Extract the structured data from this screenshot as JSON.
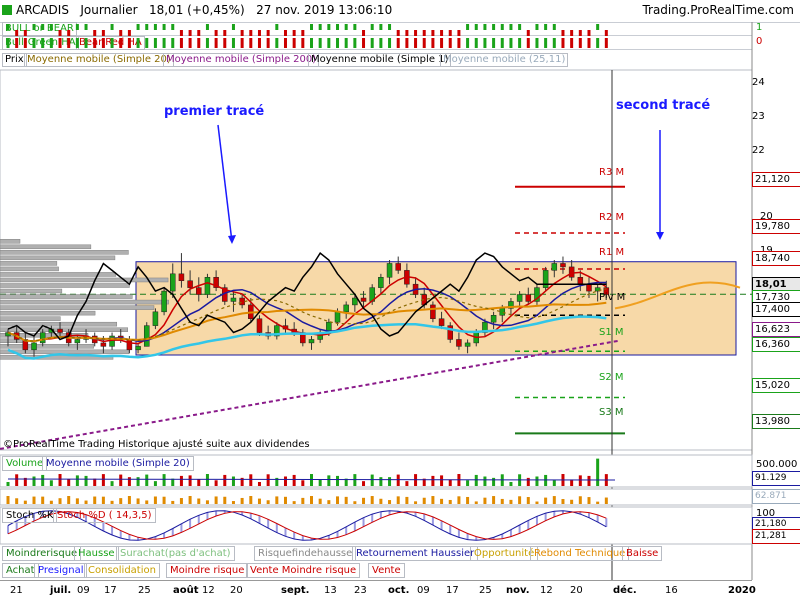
{
  "header": {
    "title": "ARCADIS   Journalier   18,01 (+0,45%)   27 nov. 2019 13:06:10",
    "source": "Trading.ProRealTime.com"
  },
  "indicator_rows": {
    "bull_bear": {
      "label": "BULL or BEAR",
      "right_value": "1"
    },
    "ha": {
      "label1": "Bull-Green HA",
      "label2": "Bear-Red HA",
      "right_value": "0"
    }
  },
  "legend": {
    "prix": "Prix",
    "mm20": "Moyenne mobile (Simple 20)",
    "mm200": "Moyenne mobile (Simple 200)",
    "mm1": "Moyenne mobile (Simple 1)",
    "extra": "Moyenne mobile (25,11)"
  },
  "annotations": {
    "first": "premier tracé",
    "second": "second tracé",
    "copyright": "©ProRealTime Trading  Historique ajusté suite aux dividendes"
  },
  "price_axis": {
    "ticks": [
      "24",
      "23",
      "22",
      "21",
      "20",
      "19",
      "18",
      "17",
      "16"
    ],
    "boxes": {
      "r3": "21,120",
      "r2": "19,780",
      "r1": "18,740",
      "current": "18,01",
      "piv_box": "17,730",
      "piv": "17,400",
      "s1": "16,623",
      "s1b": "16,360",
      "s2": "15,020",
      "s3": "13,980"
    }
  },
  "pivot_labels": {
    "r3": "R3 M",
    "r2": "R2 M",
    "r1": "R1 M",
    "piv": "Piv M",
    "s1": "S1 M",
    "s2": "S2 M",
    "s3": "S3 M"
  },
  "volume": {
    "label1": "Volume",
    "label2": "Moyenne mobile (Simple 20)",
    "right1": "500.000",
    "right2": "91.129"
  },
  "second_vol": {
    "right": "62.871"
  },
  "stoch": {
    "label1": "Stoch %K",
    "label2": "Stoch %D ( 14,3,5)",
    "ticks": [
      "100",
      "50",
      "0"
    ],
    "right1": "21,180",
    "right2": "21,281"
  },
  "signal_row1": {
    "items": [
      "Moindrerisque",
      "Hausse",
      "Surachat(pas d'achat)",
      "Risquefindehausse",
      "Retournement Haussier",
      "Opportunité",
      "Rebond Technique",
      "Baisse"
    ],
    "colors": [
      "#1a7a1a",
      "#1aa31a",
      "#7fc07f",
      "#888888",
      "#1a1aa0",
      "#c8a000",
      "#e08a00",
      "#cc0000"
    ]
  },
  "signal_row2": {
    "items": [
      "Achat",
      "Presignal",
      "Consolidation",
      "Moindre risque",
      "Vente Moindre risque",
      "Vente"
    ],
    "colors": [
      "#1a7a1a",
      "#1a1aff",
      "#c8a000",
      "#cc0000",
      "#cc0000",
      "#cc0000"
    ]
  },
  "x_axis": {
    "labels": [
      "21",
      "juil.",
      "09",
      "17",
      "25",
      "août",
      "12",
      "20",
      "sept.",
      "13",
      "23",
      "oct.",
      "09",
      "17",
      "25",
      "nov.",
      "12",
      "20",
      "déc.",
      "16",
      "2020"
    ],
    "bold": [
      "juil.",
      "août",
      "sept.",
      "oct.",
      "nov.",
      "déc.",
      "2020"
    ]
  },
  "chart_data": {
    "type": "candlestick",
    "symbol": "ARCADIS",
    "period": "Journalier",
    "ylim": [
      13.5,
      24.5
    ],
    "candles": [
      [
        16.8,
        17.0,
        16.5,
        16.9
      ],
      [
        16.9,
        17.1,
        16.6,
        16.7
      ],
      [
        16.7,
        16.9,
        16.3,
        16.4
      ],
      [
        16.4,
        16.8,
        16.2,
        16.6
      ],
      [
        16.6,
        17.0,
        16.5,
        16.9
      ],
      [
        16.9,
        17.1,
        16.7,
        17.0
      ],
      [
        17.0,
        17.2,
        16.8,
        16.9
      ],
      [
        16.9,
        17.0,
        16.5,
        16.6
      ],
      [
        16.6,
        16.8,
        16.4,
        16.7
      ],
      [
        16.7,
        17.0,
        16.6,
        16.8
      ],
      [
        16.8,
        16.9,
        16.5,
        16.6
      ],
      [
        16.6,
        16.8,
        16.3,
        16.5
      ],
      [
        16.5,
        16.9,
        16.4,
        16.8
      ],
      [
        16.8,
        17.0,
        16.6,
        16.7
      ],
      [
        16.7,
        16.8,
        16.3,
        16.4
      ],
      [
        16.4,
        16.6,
        16.3,
        16.5
      ],
      [
        16.5,
        17.2,
        16.5,
        17.1
      ],
      [
        17.1,
        17.6,
        17.0,
        17.5
      ],
      [
        17.5,
        18.2,
        17.4,
        18.1
      ],
      [
        18.1,
        18.9,
        17.9,
        18.6
      ],
      [
        18.6,
        19.2,
        18.2,
        18.4
      ],
      [
        18.4,
        18.7,
        18.0,
        18.2
      ],
      [
        18.2,
        18.5,
        17.8,
        18.0
      ],
      [
        18.0,
        18.6,
        17.9,
        18.5
      ],
      [
        18.5,
        18.7,
        18.1,
        18.2
      ],
      [
        18.2,
        18.3,
        17.7,
        17.8
      ],
      [
        17.8,
        18.1,
        17.5,
        17.9
      ],
      [
        17.9,
        18.0,
        17.6,
        17.7
      ],
      [
        17.7,
        17.9,
        17.2,
        17.3
      ],
      [
        17.3,
        17.4,
        16.8,
        16.9
      ],
      [
        16.9,
        17.1,
        16.7,
        16.8
      ],
      [
        16.8,
        17.2,
        16.7,
        17.1
      ],
      [
        17.1,
        17.3,
        16.9,
        17.0
      ],
      [
        17.0,
        17.2,
        16.8,
        16.9
      ],
      [
        16.9,
        17.0,
        16.5,
        16.6
      ],
      [
        16.6,
        16.8,
        16.4,
        16.7
      ],
      [
        16.7,
        17.0,
        16.6,
        16.9
      ],
      [
        16.9,
        17.3,
        16.8,
        17.2
      ],
      [
        17.2,
        17.6,
        17.1,
        17.5
      ],
      [
        17.5,
        17.8,
        17.3,
        17.7
      ],
      [
        17.7,
        18.0,
        17.5,
        17.9
      ],
      [
        17.9,
        18.1,
        17.6,
        17.8
      ],
      [
        17.8,
        18.3,
        17.7,
        18.2
      ],
      [
        18.2,
        18.6,
        18.0,
        18.5
      ],
      [
        18.5,
        19.0,
        18.3,
        18.9
      ],
      [
        18.9,
        19.1,
        18.6,
        18.7
      ],
      [
        18.7,
        18.9,
        18.2,
        18.3
      ],
      [
        18.3,
        18.5,
        17.9,
        18.0
      ],
      [
        18.0,
        18.2,
        17.6,
        17.7
      ],
      [
        17.7,
        17.8,
        17.2,
        17.3
      ],
      [
        17.3,
        17.5,
        17.0,
        17.1
      ],
      [
        17.1,
        17.2,
        16.6,
        16.7
      ],
      [
        16.7,
        16.9,
        16.4,
        16.5
      ],
      [
        16.5,
        16.7,
        16.3,
        16.6
      ],
      [
        16.6,
        17.0,
        16.5,
        16.9
      ],
      [
        16.9,
        17.3,
        16.8,
        17.2
      ],
      [
        17.2,
        17.5,
        17.0,
        17.4
      ],
      [
        17.4,
        17.7,
        17.2,
        17.6
      ],
      [
        17.6,
        17.9,
        17.4,
        17.8
      ],
      [
        17.8,
        18.1,
        17.6,
        18.0
      ],
      [
        18.0,
        18.2,
        17.7,
        17.8
      ],
      [
        17.8,
        18.3,
        17.7,
        18.2
      ],
      [
        18.2,
        18.8,
        18.1,
        18.7
      ],
      [
        18.7,
        19.0,
        18.5,
        18.9
      ],
      [
        18.9,
        19.1,
        18.6,
        18.8
      ],
      [
        18.8,
        19.0,
        18.4,
        18.5
      ],
      [
        18.5,
        18.7,
        18.1,
        18.3
      ],
      [
        18.3,
        18.5,
        17.9,
        18.1
      ],
      [
        18.1,
        18.3,
        17.8,
        18.2
      ],
      [
        18.2,
        18.4,
        17.9,
        18.0
      ]
    ],
    "pivots": {
      "R3": 21.12,
      "R2": 19.78,
      "R1": 18.74,
      "Piv": 17.4,
      "S1": 16.36,
      "S2": 15.02,
      "S3": 13.98
    },
    "current": 18.01,
    "mm200_start": 14.4,
    "mm200_end": 16.9
  }
}
